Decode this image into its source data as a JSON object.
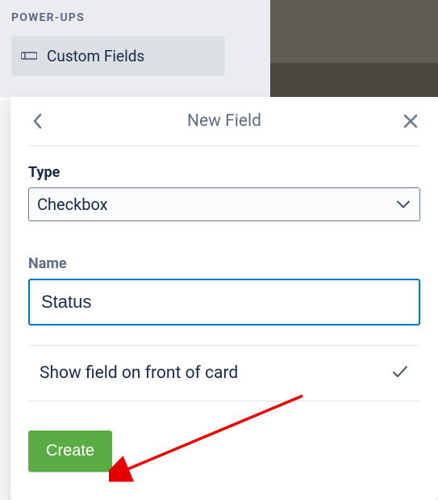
{
  "sidebar": {
    "section_label": "POWER-UPS",
    "powerup": {
      "label": "Custom Fields"
    }
  },
  "modal": {
    "title": "New Field",
    "type_label": "Type",
    "type_value": "Checkbox",
    "name_label": "Name",
    "name_value": "Status",
    "show_on_front": "Show field on front of card",
    "create_label": "Create"
  }
}
